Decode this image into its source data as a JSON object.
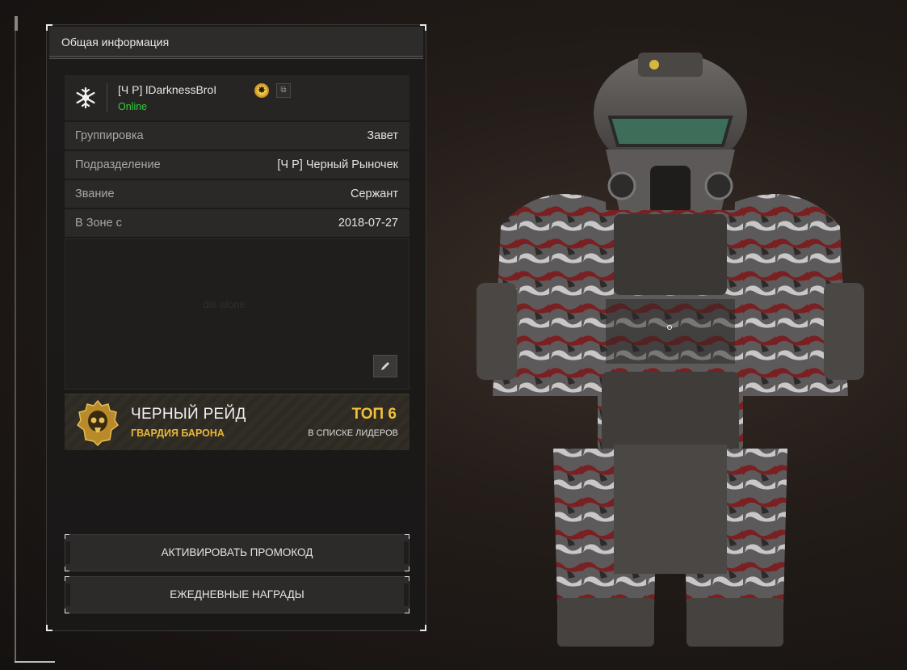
{
  "panel": {
    "title": "Общая информация"
  },
  "player": {
    "name": "[Ч  Р] lDarknessBroI",
    "status": "Online",
    "guild_icon": "snowflake-icon",
    "badge_icon": "gold-medal-icon"
  },
  "info": {
    "rows": [
      {
        "label": "Группировка",
        "value": "Завет"
      },
      {
        "label": "Подразделение",
        "value": "[Ч  Р] Черный Рыночек"
      },
      {
        "label": "Звание",
        "value": "Сержант"
      },
      {
        "label": "В Зоне с",
        "value": "2018-07-27"
      }
    ]
  },
  "bio": {
    "text": "die alone",
    "edit_icon": "pencil-icon"
  },
  "raid": {
    "title": "ЧЕРНЫЙ РЕЙД",
    "subtitle": "ГВАРДИЯ БАРОНА",
    "rank": "ТОП 6",
    "rank_caption": "В СПИСКЕ ЛИДЕРОВ",
    "emblem_icon": "skull-crest-icon"
  },
  "actions": {
    "promo_label": "АКТИВИРОВАТЬ ПРОМОКОД",
    "daily_label": "ЕЖЕДНЕВНЫЕ НАГРАДЫ"
  },
  "viewport": {
    "subject": "armored-character-model"
  },
  "colors": {
    "online": "#2ed13a",
    "gold_accent": "#f0c13c",
    "panel_bg": "#1d1b1a"
  }
}
